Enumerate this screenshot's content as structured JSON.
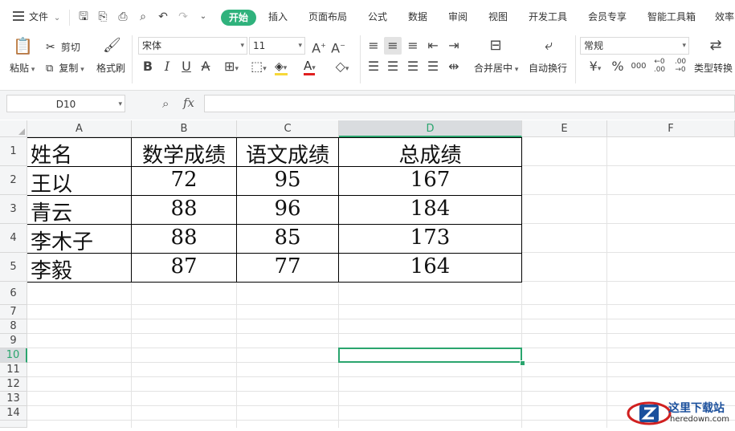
{
  "menubar": {
    "file_label": "文件",
    "tabs": [
      "开始",
      "插入",
      "页面布局",
      "公式",
      "数据",
      "审阅",
      "视图",
      "开发工具",
      "会员专享",
      "智能工具箱",
      "效率"
    ]
  },
  "ribbon": {
    "paste": "粘贴",
    "cut": "剪切",
    "copy": "复制",
    "format_painter": "格式刷",
    "font_name": "宋体",
    "font_size": "11",
    "merge_center": "合并居中",
    "wrap_text": "自动换行",
    "number_format": "常规",
    "type_convert": "类型转换",
    "bold": "B",
    "italic": "I",
    "underline": "U",
    "font_color_letter": "A",
    "currency": "¥",
    "percent": "%",
    "thousands": "000"
  },
  "formula_bar": {
    "name_box": "D10",
    "fx": "fx",
    "content": ""
  },
  "sheet": {
    "columns": [
      "A",
      "B",
      "C",
      "D",
      "E",
      "F"
    ],
    "rows": [
      "1",
      "2",
      "3",
      "4",
      "5",
      "6",
      "7",
      "8",
      "9",
      "10",
      "11",
      "12",
      "13",
      "14"
    ],
    "header_row": [
      "姓名",
      "数学成绩",
      "语文成绩",
      "总成绩"
    ],
    "data_rows": [
      [
        "王以",
        "72",
        "95",
        "167"
      ],
      [
        "青云",
        "88",
        "96",
        "184"
      ],
      [
        "李木子",
        "88",
        "85",
        "173"
      ],
      [
        "李毅",
        "87",
        "77",
        "164"
      ]
    ],
    "selected_cell": "D10"
  },
  "watermark": {
    "title": "这里下载站",
    "url": "heredown.com"
  },
  "colors": {
    "accent": "#2fb27c",
    "selection": "#2aa56e"
  }
}
